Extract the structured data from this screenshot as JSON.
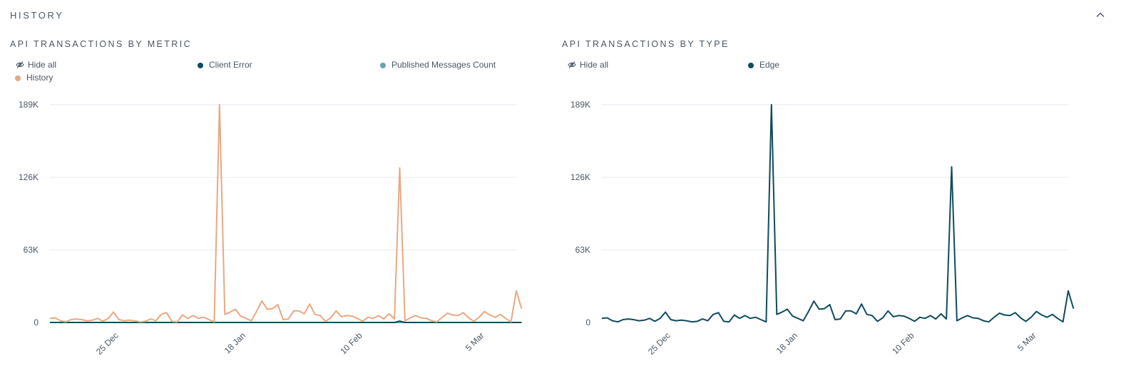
{
  "section": {
    "title": "HISTORY"
  },
  "icons": {
    "collapse": "chevron-up-icon",
    "hide_all": "eye-slash-icon"
  },
  "colors": {
    "history": "#e8a882",
    "client_error": "#0f4c5c",
    "published": "#6aa3ad",
    "edge": "#0f4c5c",
    "grid": "#e6e9ec"
  },
  "left": {
    "title": "API TRANSACTIONS BY METRIC",
    "legend": {
      "hide_all": "Hide all",
      "client_error": "Client Error",
      "published": "Published Messages Count",
      "history": "History"
    }
  },
  "right": {
    "title": "API TRANSACTIONS BY TYPE",
    "legend": {
      "hide_all": "Hide all",
      "edge": "Edge"
    }
  },
  "chart_data": [
    {
      "type": "line",
      "title": "API TRANSACTIONS BY METRIC",
      "ylim": [
        0,
        189000
      ],
      "yticks": [
        0,
        63000,
        126000,
        189000
      ],
      "ytick_labels": [
        "0",
        "63K",
        "126K",
        "189K"
      ],
      "xtick_labels": [
        "25 Dec",
        "18 Jan",
        "10 Feb",
        "5 Mar"
      ],
      "xtick_positions": [
        13,
        37,
        59,
        82
      ],
      "x_count": 89,
      "series": [
        {
          "name": "History",
          "color": "#e8a882",
          "values": [
            3500,
            4000,
            1500,
            500,
            2500,
            3000,
            2500,
            1500,
            2000,
            3500,
            1000,
            3500,
            9000,
            2500,
            1500,
            2000,
            1500,
            500,
            1000,
            3000,
            1500,
            7000,
            8500,
            1000,
            500,
            6500,
            3500,
            6000,
            3500,
            4500,
            2500,
            500,
            189000,
            7000,
            9000,
            11500,
            5500,
            3500,
            1500,
            9500,
            18500,
            11500,
            12000,
            15500,
            2500,
            3000,
            10000,
            10000,
            7500,
            16000,
            7000,
            6000,
            1000,
            4000,
            10000,
            5000,
            6000,
            5500,
            3500,
            1000,
            4500,
            3500,
            6000,
            3000,
            7500,
            3000,
            134000,
            1500,
            4000,
            6000,
            4000,
            3500,
            1500,
            500,
            4500,
            8000,
            6500,
            6000,
            8500,
            4000,
            1000,
            4500,
            9500,
            6500,
            4500,
            7000,
            3500,
            500,
            27500,
            12000
          ]
        },
        {
          "name": "Client Error",
          "color": "#0f4c5c",
          "values": [
            0,
            0,
            0,
            0,
            0,
            0,
            0,
            0,
            0,
            0,
            0,
            0,
            0,
            0,
            0,
            0,
            0,
            0,
            0,
            0,
            0,
            0,
            0,
            0,
            0,
            0,
            0,
            0,
            0,
            0,
            0,
            0,
            0,
            0,
            0,
            0,
            0,
            0,
            0,
            0,
            0,
            0,
            0,
            0,
            0,
            0,
            0,
            0,
            0,
            0,
            0,
            0,
            0,
            0,
            0,
            0,
            0,
            0,
            0,
            0,
            0,
            0,
            0,
            0,
            0,
            0,
            1200,
            0,
            0,
            0,
            0,
            0,
            0,
            0,
            0,
            0,
            0,
            0,
            0,
            0,
            0,
            0,
            0,
            0,
            0,
            0,
            0,
            0,
            0,
            0
          ]
        },
        {
          "name": "Published Messages Count",
          "color": "#6aa3ad",
          "values": [
            0,
            0,
            0,
            0,
            0,
            0,
            0,
            0,
            0,
            0,
            0,
            0,
            0,
            0,
            0,
            0,
            0,
            0,
            0,
            0,
            0,
            0,
            0,
            0,
            0,
            0,
            0,
            0,
            0,
            0,
            0,
            0,
            0,
            0,
            0,
            0,
            0,
            0,
            0,
            0,
            0,
            0,
            0,
            0,
            0,
            0,
            0,
            0,
            0,
            0,
            0,
            0,
            0,
            0,
            0,
            0,
            0,
            0,
            0,
            0,
            0,
            0,
            0,
            0,
            0,
            0,
            0,
            0,
            0,
            0,
            0,
            0,
            0,
            0,
            0,
            0,
            0,
            0,
            0,
            0,
            0,
            0,
            0,
            0,
            0,
            0,
            0,
            0,
            0,
            0
          ]
        }
      ]
    },
    {
      "type": "line",
      "title": "API TRANSACTIONS BY TYPE",
      "ylim": [
        0,
        189000
      ],
      "yticks": [
        0,
        63000,
        126000,
        189000
      ],
      "ytick_labels": [
        "0",
        "63K",
        "126K",
        "189K"
      ],
      "xtick_labels": [
        "25 Dec",
        "18 Jan",
        "10 Feb",
        "5 Mar"
      ],
      "xtick_positions": [
        13,
        37,
        59,
        82
      ],
      "x_count": 89,
      "series": [
        {
          "name": "Edge",
          "color": "#0f4c5c",
          "values": [
            3500,
            4000,
            1500,
            500,
            2500,
            3000,
            2500,
            1500,
            2000,
            3500,
            1000,
            3500,
            9000,
            2500,
            1500,
            2000,
            1500,
            500,
            1000,
            3000,
            1500,
            7000,
            8500,
            1000,
            500,
            6500,
            3500,
            6000,
            3500,
            4500,
            2500,
            500,
            189000,
            7000,
            9000,
            11500,
            5500,
            3500,
            1500,
            9500,
            18500,
            11500,
            12000,
            15500,
            2500,
            3000,
            10000,
            10000,
            7500,
            16000,
            7000,
            6000,
            1000,
            4000,
            10000,
            5000,
            6000,
            5500,
            3500,
            1000,
            4500,
            3500,
            6000,
            3000,
            7500,
            3000,
            135000,
            1500,
            4000,
            6000,
            4000,
            3500,
            1500,
            500,
            4500,
            8000,
            6500,
            6000,
            8500,
            4000,
            1000,
            4500,
            9500,
            6500,
            4500,
            7000,
            3500,
            500,
            27500,
            12000
          ]
        }
      ]
    }
  ]
}
